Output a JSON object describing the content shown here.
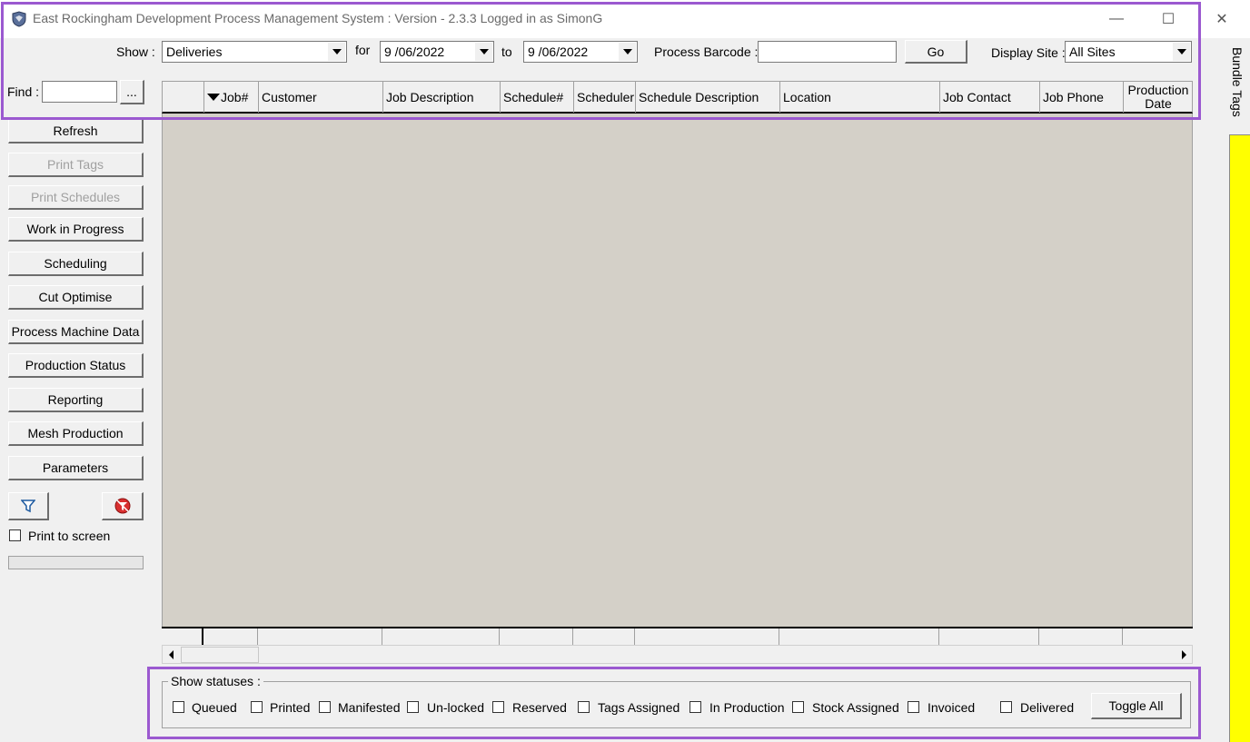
{
  "window": {
    "title": "East Rockingham Development Process Management System : Version - 2.3.3 Logged in as SimonG",
    "min_glyph": "—",
    "max_glyph": "☐",
    "close_glyph": "✕"
  },
  "toolbar": {
    "show_label": "Show :",
    "show_value": "Deliveries",
    "for_label": "for",
    "from_date": "9 /06/2022",
    "to_label": "to",
    "to_date": "9 /06/2022",
    "barcode_label": "Process Barcode :",
    "barcode_value": "",
    "go_label": "Go",
    "display_site_label": "Display Site :",
    "display_site_value": "All Sites"
  },
  "find": {
    "label": "Find :",
    "value": "",
    "browse_label": "..."
  },
  "grid": {
    "columns": [
      "",
      "Job#",
      "Customer",
      "Job Description",
      "Schedule#",
      "Scheduler",
      "Schedule Description",
      "Location",
      "Job Contact",
      "Job Phone",
      "Production Date"
    ],
    "sorted_column": "Job#",
    "sort_direction": "descending",
    "rows": []
  },
  "sidebar": {
    "buttons": [
      {
        "label": "Refresh",
        "enabled": true
      },
      {
        "label": "Print Tags",
        "enabled": false
      },
      {
        "label": "Print Schedules",
        "enabled": false
      },
      {
        "label": "Work in Progress",
        "enabled": true
      },
      {
        "label": "Scheduling",
        "enabled": true
      },
      {
        "label": "Cut Optimise",
        "enabled": true
      },
      {
        "label": "Process Machine Data",
        "enabled": true
      },
      {
        "label": "Production Status",
        "enabled": true
      },
      {
        "label": "Reporting",
        "enabled": true
      },
      {
        "label": "Mesh Production",
        "enabled": true
      },
      {
        "label": "Parameters",
        "enabled": true
      }
    ],
    "filter_icon": "funnel-icon",
    "clear_filter_icon": "clear-filter-icon",
    "print_to_screen_label": "Print to screen",
    "print_to_screen_checked": false,
    "progress": 0
  },
  "statuses": {
    "title": "Show statuses :",
    "items": [
      {
        "label": "Queued",
        "checked": false
      },
      {
        "label": "Printed",
        "checked": false
      },
      {
        "label": "Manifested",
        "checked": false
      },
      {
        "label": "Un-locked",
        "checked": false
      },
      {
        "label": "Reserved",
        "checked": false
      },
      {
        "label": "Tags Assigned",
        "checked": false
      },
      {
        "label": "In Production",
        "checked": false
      },
      {
        "label": "Stock Assigned",
        "checked": false
      },
      {
        "label": "Invoiced",
        "checked": false
      },
      {
        "label": "Delivered",
        "checked": false
      }
    ],
    "toggle_all_label": "Toggle All"
  },
  "side_panel": {
    "tab_label": "Bundle Tags",
    "panel_color": "#ffff00"
  },
  "colors": {
    "highlight": "#9b59d0",
    "grid_body": "#d4d0c8"
  }
}
